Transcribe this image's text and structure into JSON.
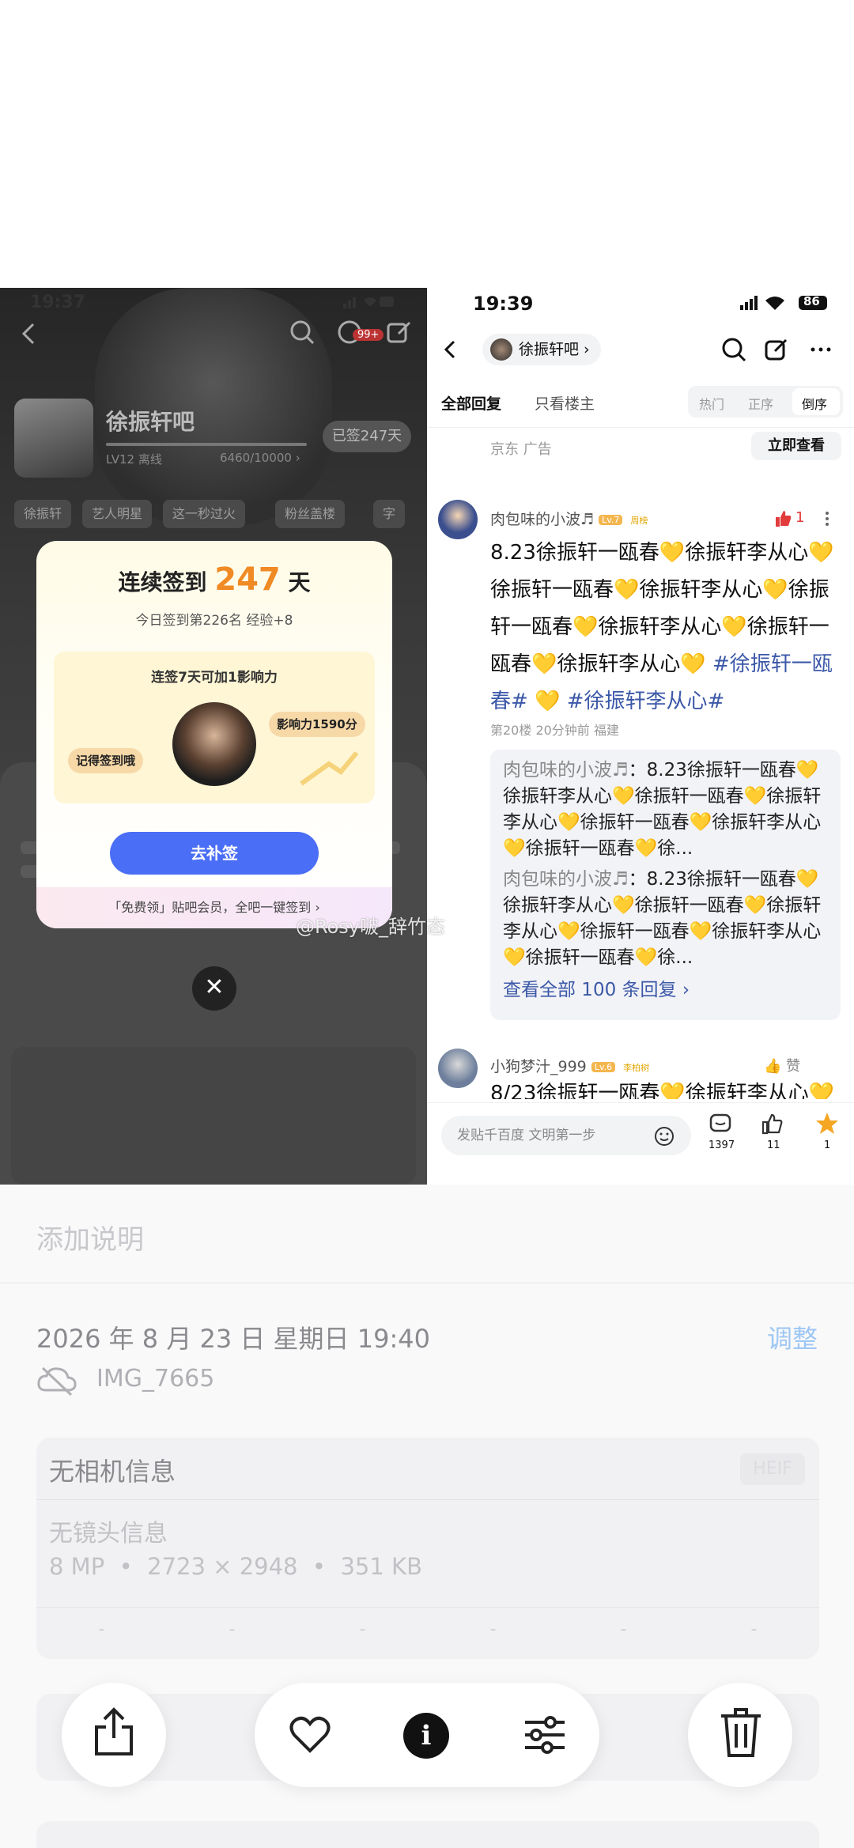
{
  "left_app": {
    "status_time": "19:37",
    "status_battery": "86",
    "notif_badge": "99+",
    "bar_title": "徐振轩吧",
    "level": "LV12 离线",
    "exp": "6460/10000 ›",
    "signed_badge": "已签247天",
    "chips": [
      "徐振轩",
      "艺人明星",
      "这一秒过火",
      "粉丝盖楼",
      "字"
    ],
    "modal": {
      "title_prefix": "连续签到",
      "streak": "247",
      "title_suffix": "天",
      "subtitle": "今日签到第226名 经验+8",
      "tip": "连签7天可加1影响力",
      "influence": "影响力1590分",
      "remember": "记得签到哦",
      "button": "去补签",
      "footer": "「免费领」贴吧会员，全吧一键签到 ›"
    },
    "close_symbol": "✕"
  },
  "right_app": {
    "status_time": "19:39",
    "status_battery": "86",
    "forum_name": "徐振轩吧 ›",
    "tabs": {
      "all": "全部回复",
      "owner": "只看楼主"
    },
    "sort": [
      "热门",
      "正序",
      "倒序"
    ],
    "ad": {
      "text": "京东  广告",
      "button": "立即查看"
    },
    "post1": {
      "user": "肉包味的小波♬",
      "level": "Lv.7",
      "badge": "周榜",
      "likes": "1",
      "content": "8.23徐振轩一瓯春💛徐振轩李从心💛徐振轩一瓯春💛徐振轩李从心💛徐振轩一瓯春💛徐振轩李从心💛徐振轩一瓯春💛徐振轩李从心💛 ",
      "tag1": "#徐振轩一瓯春#",
      "tag2": "#徐振轩李从心#",
      "meta": "第20楼  20分钟前  福建"
    },
    "quote": {
      "r1_user": "肉包味的小波♬",
      "r1_text": "：8.23徐振轩一瓯春💛徐振轩李从心💛徐振轩一瓯春💛徐振轩李从心💛徐振轩一瓯春💛徐振轩李从心💛徐振轩一瓯春💛徐...",
      "r2_user": "肉包味的小波♬",
      "r2_text": "：8.23徐振轩一瓯春💛徐振轩李从心💛徐振轩一瓯春💛徐振轩李从心💛徐振轩一瓯春💛徐振轩李从心💛徐振轩一瓯春💛徐...",
      "more": "查看全部 100 条回复 ›"
    },
    "post2": {
      "user": "小狗梦汁_999",
      "level": "Lv.6",
      "badge": "李柏树",
      "like_label": "赞",
      "content": "8/23徐振轩一瓯春💛徐振轩李从心💛"
    },
    "input_placeholder": "发贴千百度 文明第一步",
    "counts": {
      "comments": "1397",
      "likes": "11",
      "stars": "1"
    }
  },
  "watermark": "@Rosy啵_辞竹态",
  "photo_info": {
    "caption_placeholder": "添加说明",
    "datetime": "2026 年 8 月 23 日 星期日 19:40",
    "adjust": "调整",
    "filename": "IMG_7665",
    "camera": "无相机信息",
    "format_badge": "HEIF",
    "lens": "无镜头信息",
    "specs": "8 MP  •  2723 × 2948  •  351 KB",
    "exif_placeholders": [
      "-",
      "-",
      "-",
      "-",
      "-",
      "-"
    ]
  },
  "toolbar_icons": [
    "share-icon",
    "heart-icon",
    "info-icon",
    "adjust-icon",
    "trash-icon"
  ]
}
